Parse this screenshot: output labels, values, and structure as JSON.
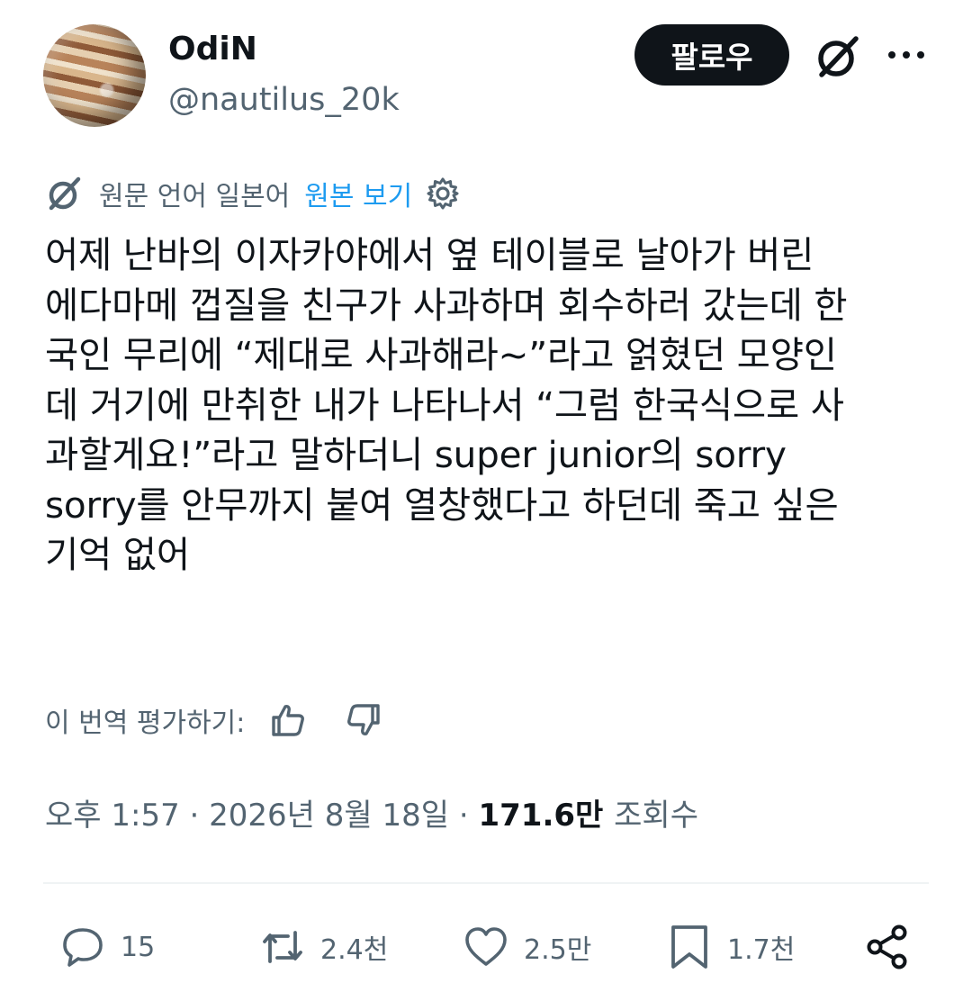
{
  "author": {
    "name": "OdiN",
    "handle": "@nautilus_20k"
  },
  "header": {
    "follow_label": "팔로우"
  },
  "translation": {
    "source_language": "원문 언어 일본어",
    "show_original": "원본 보기"
  },
  "tweet": {
    "lines": [
      "어제 난바의 이자카야에서 옆 테이블로 날아가 버린",
      "에다마메 껍질을 친구가 사과하며 회수하러 갔는데 한",
      "국인 무리에 “제대로 사과해라~”라고 얽혔던 모양인",
      "데 거기에 만취한 내가 나타나서 “그럼 한국식으로 사",
      "과할게요!”라고 말하더니 super junior의 sorry",
      "sorry를 안무까지 붙여 열창했다고 하던데 죽고 싶은",
      "기억 없어"
    ]
  },
  "rating": {
    "label": "이 번역 평가하기:"
  },
  "meta": {
    "time": "오후 1:57",
    "date": "2026년 8월 18일",
    "separator": "·",
    "views_count": "171.6만",
    "views_label": "조회수"
  },
  "actions": {
    "replies": "15",
    "reposts": "2.4천",
    "likes": "2.5만",
    "bookmarks": "1.7천"
  },
  "icons": {
    "grok": "grok-icon",
    "more": "more-icon",
    "translate": "translate-icon",
    "settings": "gear-icon",
    "thumbs_up": "thumbs-up-icon",
    "thumbs_down": "thumbs-down-icon",
    "reply": "reply-icon",
    "repost": "repost-icon",
    "like": "heart-icon",
    "bookmark": "bookmark-icon",
    "share": "share-icon"
  },
  "colors": {
    "text": "#0f1419",
    "secondary": "#536471",
    "link": "#1d9bf0",
    "button_bg": "#0f1419",
    "divider": "#eff3f4"
  }
}
